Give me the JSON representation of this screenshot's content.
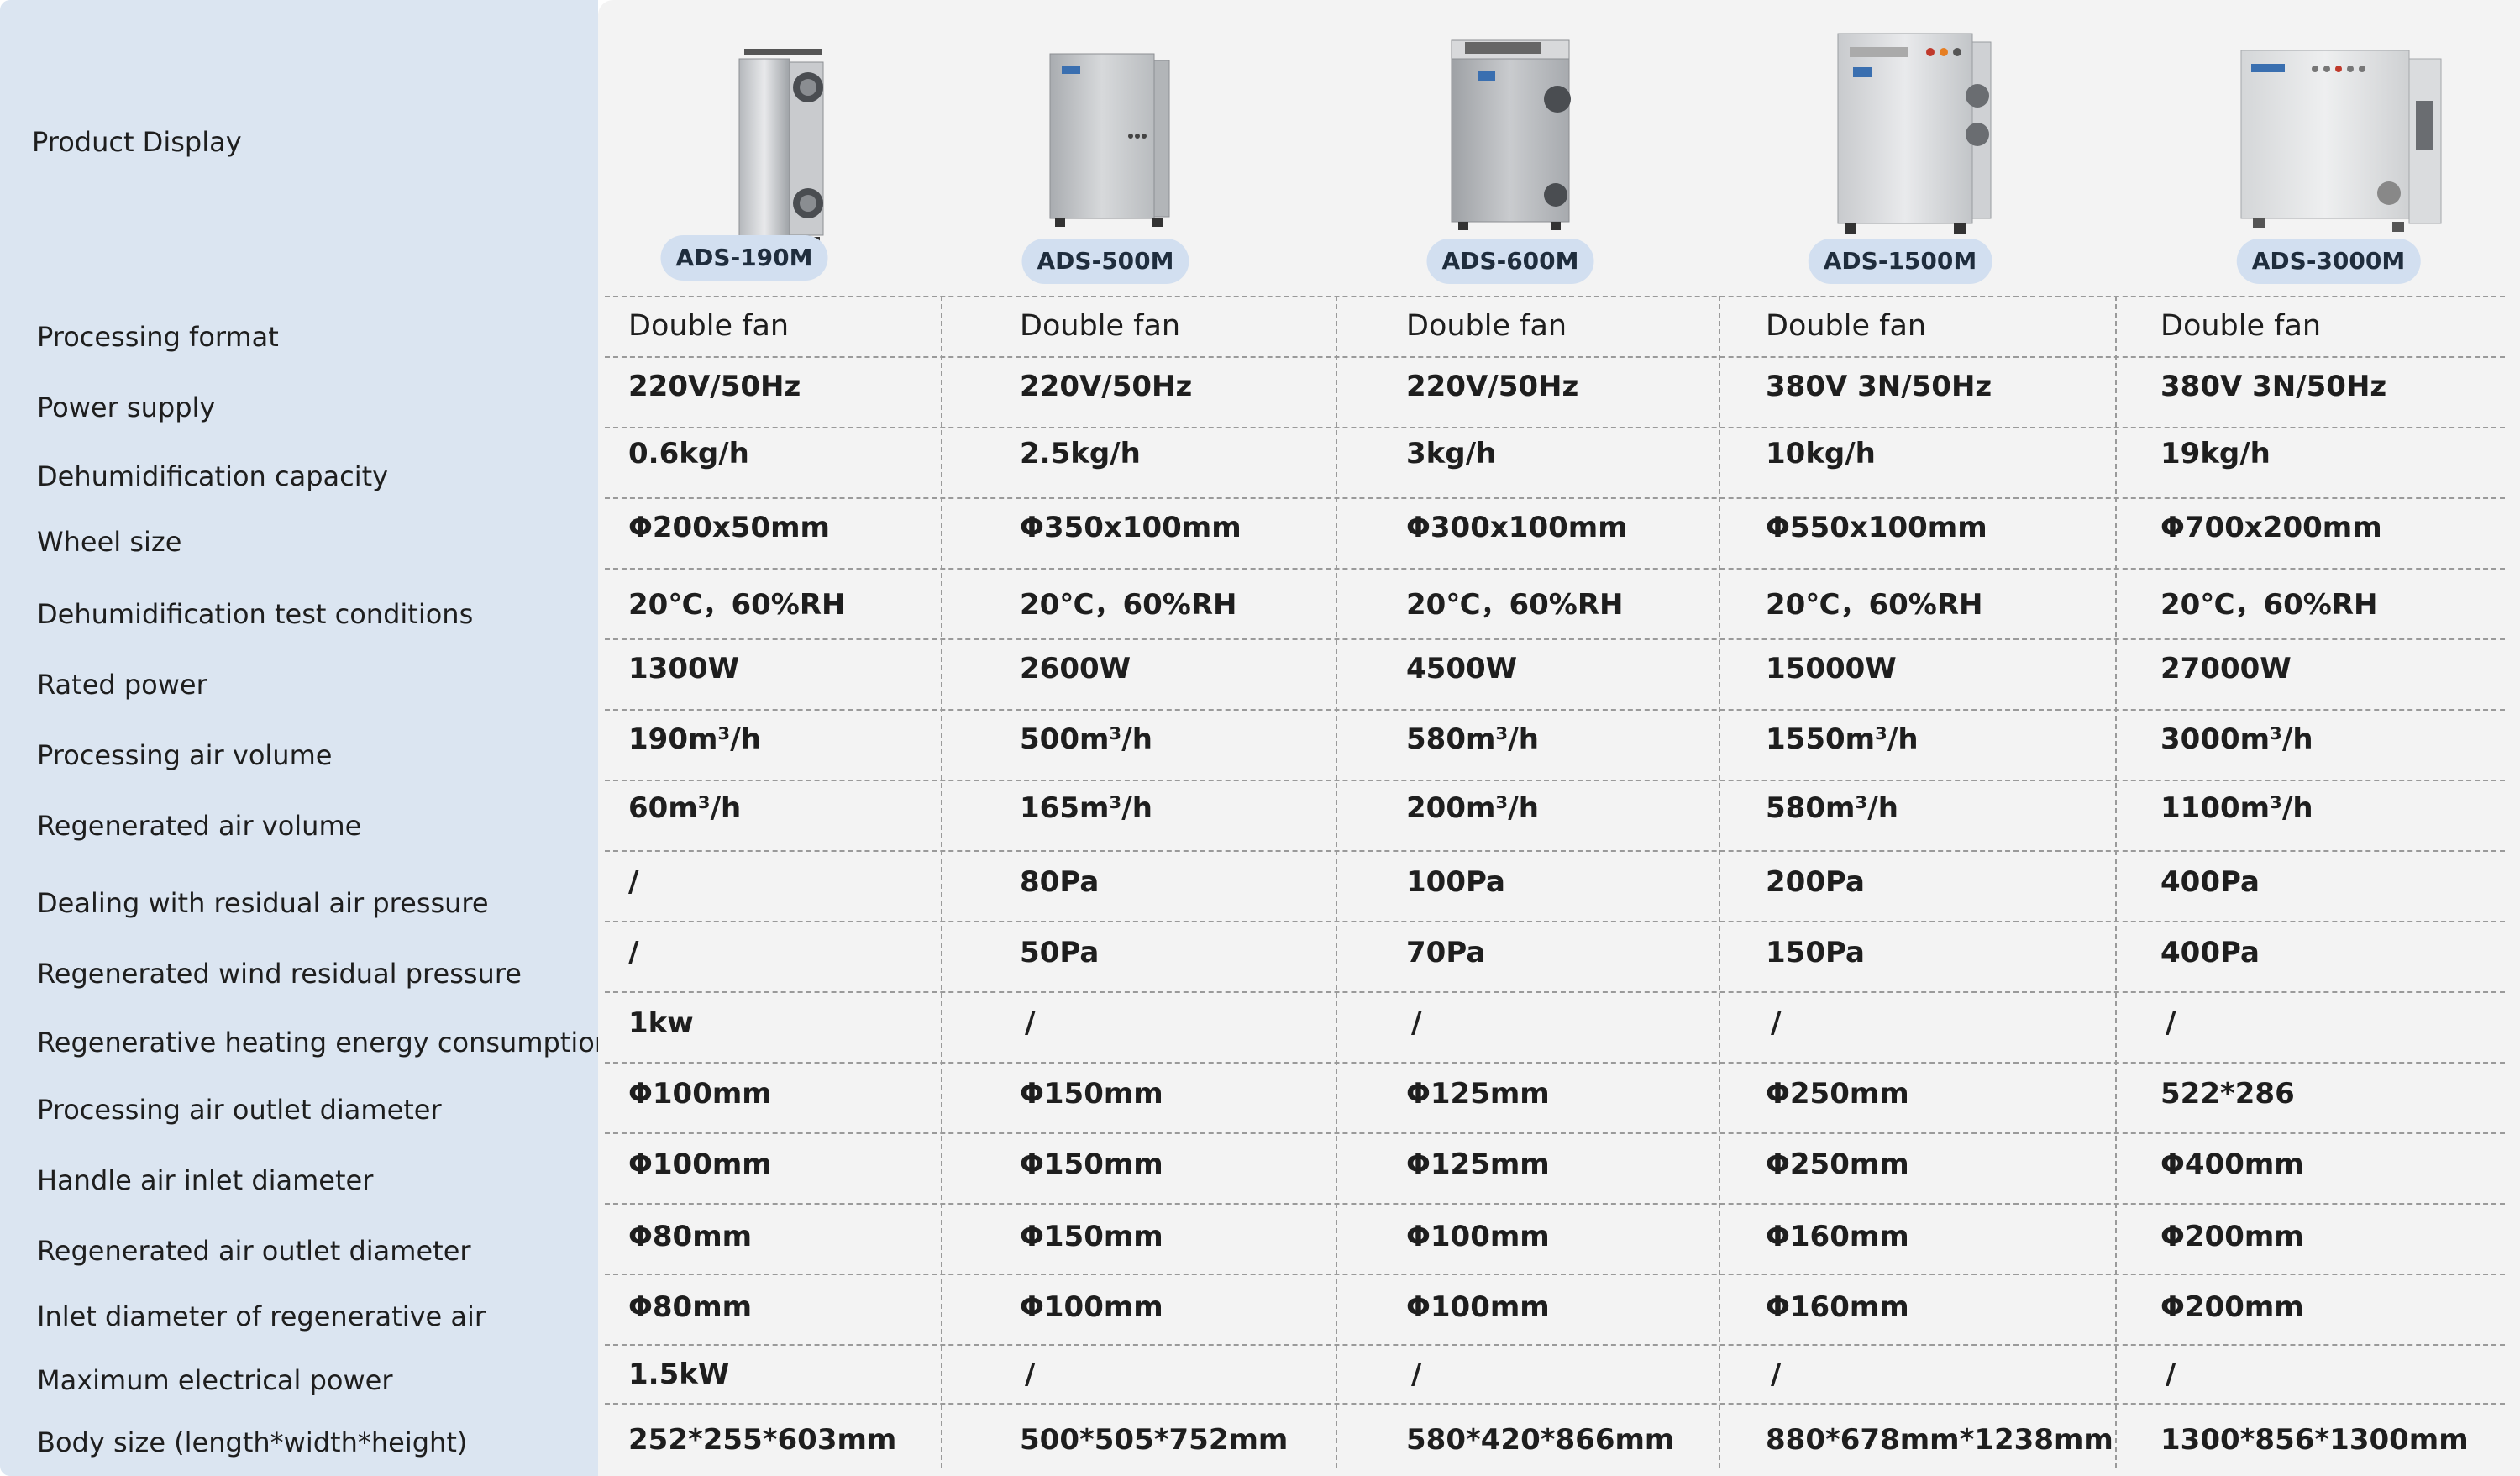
{
  "header_label": "Product Display",
  "products": [
    {
      "model": "ADS-190M"
    },
    {
      "model": "ADS-500M"
    },
    {
      "model": "ADS-600M"
    },
    {
      "model": "ADS-1500M"
    },
    {
      "model": "ADS-3000M"
    }
  ],
  "rows": [
    {
      "label": "Processing format",
      "values": [
        "Double fan",
        "Double fan",
        "Double fan",
        "Double fan",
        "Double fan"
      ]
    },
    {
      "label": "Power supply",
      "values": [
        "220V/50Hz",
        "220V/50Hz",
        "220V/50Hz",
        "380V 3N/50Hz",
        "380V 3N/50Hz"
      ]
    },
    {
      "label": "Dehumidification capacity",
      "values": [
        "0.6kg/h",
        "2.5kg/h",
        "3kg/h",
        "10kg/h",
        "19kg/h"
      ]
    },
    {
      "label": "Wheel size",
      "values": [
        "Φ200x50mm",
        "Φ350x100mm",
        "Φ300x100mm",
        "Φ550x100mm",
        "Φ700x200mm"
      ]
    },
    {
      "label": "Dehumidification test conditions",
      "values": [
        "20℃，60%RH",
        "20℃，60%RH",
        "20℃，60%RH",
        "20℃，60%RH",
        "20℃，60%RH"
      ]
    },
    {
      "label": "Rated power",
      "values": [
        "1300W",
        "2600W",
        "4500W",
        "15000W",
        "27000W"
      ]
    },
    {
      "label": "Processing air volume",
      "values": [
        "190m³/h",
        "500m³/h",
        "580m³/h",
        "1550m³/h",
        "3000m³/h"
      ]
    },
    {
      "label": "Regenerated air volume",
      "values": [
        "60m³/h",
        "165m³/h",
        "200m³/h",
        "580m³/h",
        "1100m³/h"
      ]
    },
    {
      "label": "Dealing with residual air pressure",
      "values": [
        "/",
        "80Pa",
        "100Pa",
        "200Pa",
        "400Pa"
      ]
    },
    {
      "label": "Regenerated wind residual pressure",
      "values": [
        "/",
        "50Pa",
        "70Pa",
        "150Pa",
        "400Pa"
      ]
    },
    {
      "label": "Regenerative heating energy consumption",
      "values": [
        "1kw",
        "/",
        "/",
        "/",
        "/"
      ]
    },
    {
      "label": "Processing air outlet diameter",
      "values": [
        "Φ100mm",
        "Φ150mm",
        "Φ125mm",
        "Φ250mm",
        "522*286"
      ]
    },
    {
      "label": "Handle air inlet diameter",
      "values": [
        "Φ100mm",
        "Φ150mm",
        "Φ125mm",
        "Φ250mm",
        "Φ400mm"
      ]
    },
    {
      "label": "Regenerated air outlet diameter",
      "values": [
        "Φ80mm",
        "Φ150mm",
        "Φ100mm",
        "Φ160mm",
        "Φ200mm"
      ]
    },
    {
      "label": "Inlet diameter of regenerative air",
      "values": [
        "Φ80mm",
        "Φ100mm",
        "Φ100mm",
        "Φ160mm",
        "Φ200mm"
      ]
    },
    {
      "label": "Maximum electrical power",
      "values": [
        "1.5kW",
        "/",
        "/",
        "/",
        "/"
      ]
    },
    {
      "label": "Body size (length*width*height)",
      "values": [
        "252*255*603mm",
        "500*505*752mm",
        "580*420*866mm",
        "880*678mm*1238mm",
        "1300*856*1300mm"
      ]
    }
  ],
  "colors": {
    "sidebar": "#dbe5f1",
    "panel": "#f3f3f3",
    "badge": "#d2dff0",
    "divider": "#9a9a9a"
  }
}
